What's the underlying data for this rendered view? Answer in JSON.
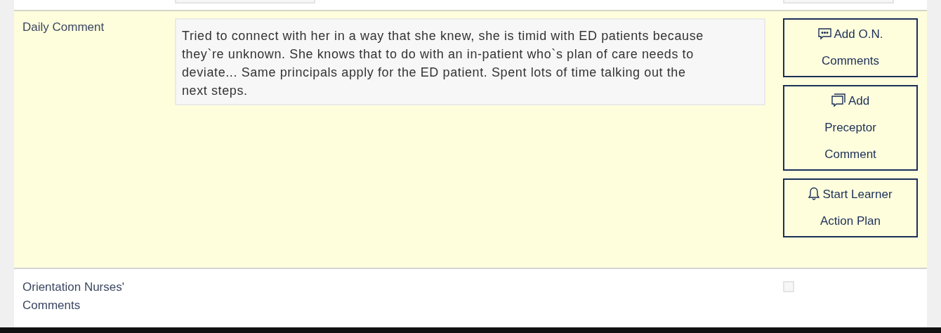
{
  "rows": [
    {
      "label": "Daily Comment",
      "comment": "Tried to connect with her in a way that she knew, she is timid with ED patients because they`re unknown. She knows that to do with an in-patient who`s plan of care needs to deviate... Same principals apply for the ED patient. Spent lots of time talking out the next steps.",
      "buttons": [
        {
          "label": "Add O.N. Comments"
        },
        {
          "label": "Add Preceptor Comment"
        },
        {
          "label": "Start Learner Action Plan"
        }
      ]
    },
    {
      "label": "Orientation Nurses' Comments",
      "checkbox": {
        "checked": false
      }
    }
  ]
}
